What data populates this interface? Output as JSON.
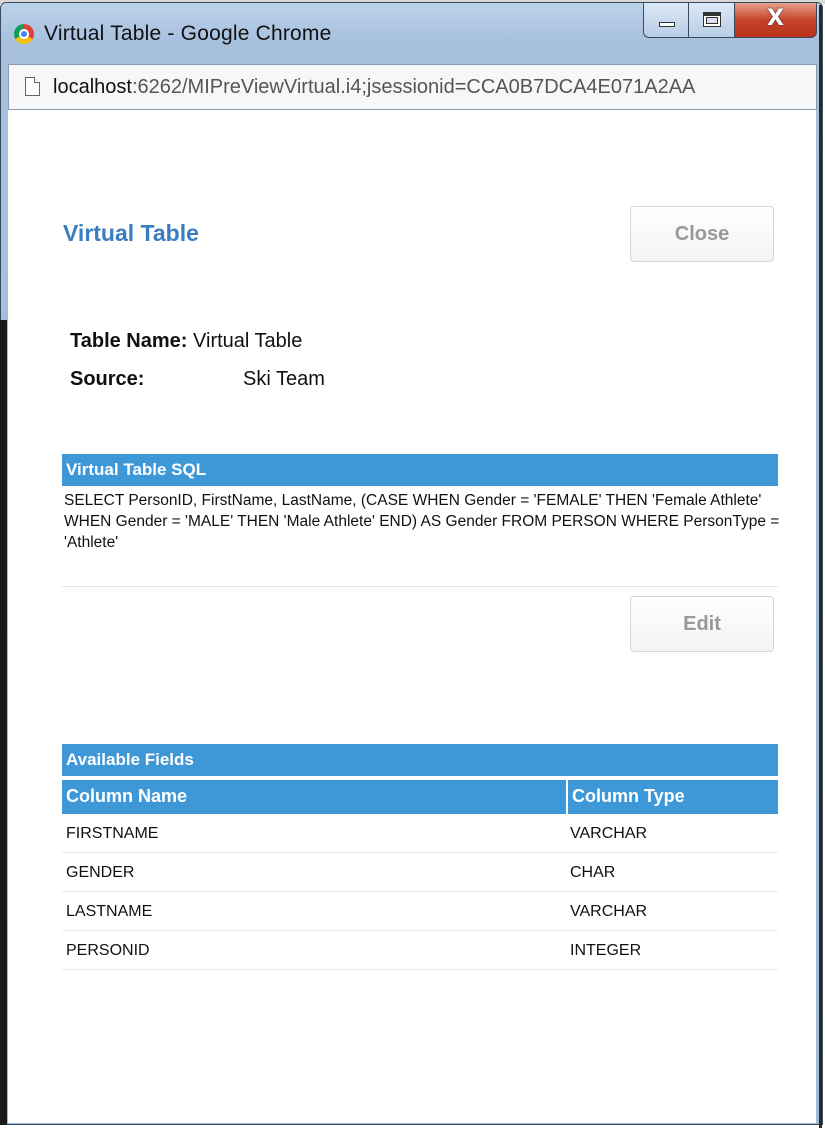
{
  "window": {
    "title": "Virtual Table - Google Chrome",
    "close_glyph": "X"
  },
  "address": {
    "host": "localhost",
    "path": ":6262/MIPreViewVirtual.i4;jsessionid=CCA0B7DCA4E071A2AA"
  },
  "page": {
    "title": "Virtual Table",
    "close_label": "Close",
    "edit_label": "Edit"
  },
  "info": {
    "table_name_label": "Table Name:",
    "table_name_value": "Virtual Table",
    "source_label": "Source:",
    "source_value": "Ski Team"
  },
  "sql": {
    "header": "Virtual Table SQL",
    "text": "SELECT PersonID, FirstName, LastName, (CASE WHEN Gender = 'FEMALE' THEN 'Female Athlete' WHEN Gender = 'MALE' THEN 'Male Athlete' END) AS Gender FROM PERSON WHERE PersonType = 'Athlete'"
  },
  "fields": {
    "header": "Available Fields",
    "columns": [
      "Column Name",
      "Column Type"
    ],
    "rows": [
      {
        "name": "FIRSTNAME",
        "type": "VARCHAR"
      },
      {
        "name": "GENDER",
        "type": "CHAR"
      },
      {
        "name": "LASTNAME",
        "type": "VARCHAR"
      },
      {
        "name": "PERSONID",
        "type": "INTEGER"
      }
    ]
  }
}
